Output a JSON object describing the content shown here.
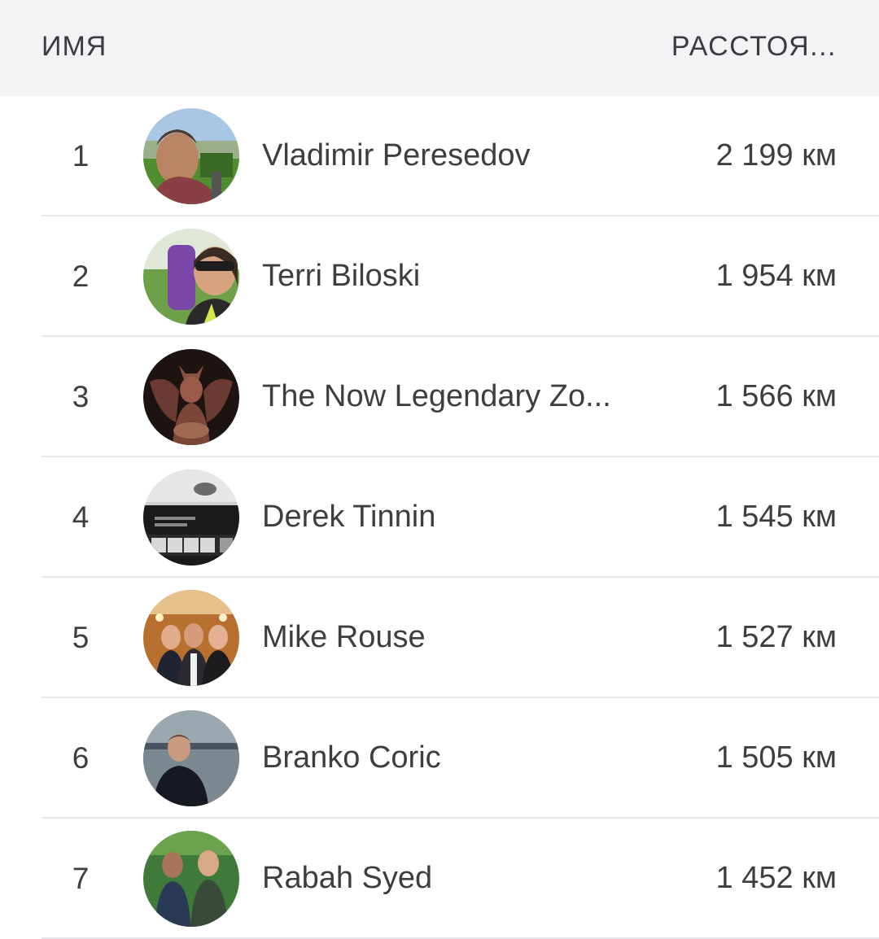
{
  "header": {
    "name_label": "ИМЯ",
    "distance_label": "РАССТОЯ..."
  },
  "rows": [
    {
      "rank": "1",
      "name": "Vladimir Peresedov",
      "distance": "2 199 км",
      "avatar": "person-outdoors-avatar"
    },
    {
      "rank": "2",
      "name": "Terri Biloski",
      "distance": "1 954 км",
      "avatar": "woman-sunglasses-avatar"
    },
    {
      "rank": "3",
      "name": "The Now Legendary Zo...",
      "distance": "1 566 км",
      "avatar": "statue-avatar"
    },
    {
      "rank": "4",
      "name": "Derek Tinnin",
      "distance": "1 545 км",
      "avatar": "treadmill-display-avatar"
    },
    {
      "rank": "5",
      "name": "Mike Rouse",
      "distance": "1 527 км",
      "avatar": "group-photo-avatar"
    },
    {
      "rank": "6",
      "name": "Branko Coric",
      "distance": "1 505 км",
      "avatar": "man-lake-avatar"
    },
    {
      "rank": "7",
      "name": "Rabah Syed",
      "distance": "1 452 км",
      "avatar": "two-men-avatar"
    }
  ],
  "colors": {
    "header_bg": "#f3f3f6",
    "divider": "#e4e4e9",
    "text": "#3d3d42"
  }
}
